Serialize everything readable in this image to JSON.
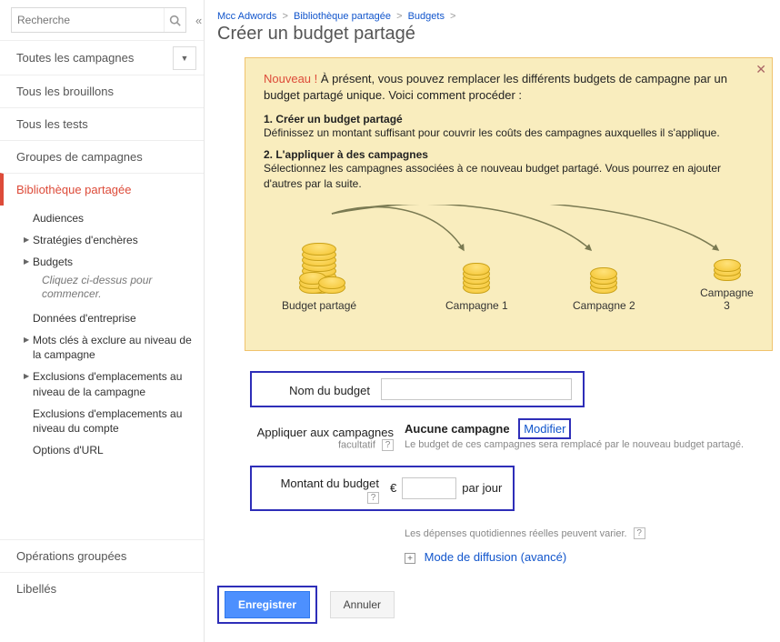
{
  "sidebar": {
    "search_placeholder": "Recherche",
    "all_campaigns": "Toutes les campagnes",
    "items": [
      {
        "label": "Tous les brouillons"
      },
      {
        "label": "Tous les tests"
      },
      {
        "label": "Groupes de campagnes"
      },
      {
        "label": "Bibliothèque partagée"
      }
    ],
    "shared_library_sub": [
      {
        "label": "Audiences",
        "arrow": false
      },
      {
        "label": "Stratégies d'enchères",
        "arrow": true
      },
      {
        "label": "Budgets",
        "arrow": true,
        "hint": "Cliquez ci-dessus pour commencer."
      },
      {
        "label": "Données d'entreprise",
        "arrow": false
      },
      {
        "label": "Mots clés à exclure au niveau de la campagne",
        "arrow": true
      },
      {
        "label": "Exclusions d'emplacements au niveau de la campagne",
        "arrow": true
      },
      {
        "label": "Exclusions d'emplacements au niveau du compte",
        "arrow": false
      },
      {
        "label": "Options d'URL",
        "arrow": false
      }
    ],
    "bulk_ops": "Opérations groupées",
    "labels": "Libellés"
  },
  "breadcrumbs": {
    "a": "Mcc Adwords",
    "b": "Bibliothèque partagée",
    "c": "Budgets"
  },
  "page_title": "Créer un budget partagé",
  "promo": {
    "tag": "Nouveau !",
    "lead": "À présent, vous pouvez remplacer les différents budgets de campagne par un budget partagé unique. Voici comment procéder :",
    "step1_t": "1. Créer un budget partagé",
    "step1_d": "Définissez un montant suffisant pour couvrir les coûts des campagnes auxquelles il s'applique.",
    "step2_t": "2. L'appliquer à des campagnes",
    "step2_d": "Sélectionnez les campagnes associées à ce nouveau budget partagé. Vous pourrez en ajouter d'autres par la suite.",
    "cap_shared": "Budget partagé",
    "cap_c1": "Campagne 1",
    "cap_c2": "Campagne 2",
    "cap_c3": "Campagne 3"
  },
  "form": {
    "name_label": "Nom du budget",
    "name_value": "",
    "apply_label": "Appliquer aux campagnes",
    "apply_sub": "facultatif",
    "no_campaign": "Aucune campagne",
    "modify": "Modifier",
    "apply_hint": "Le budget de ces campagnes sera remplacé par le nouveau budget partagé.",
    "amount_label": "Montant du budget",
    "currency": "€",
    "amount_value": "",
    "per_day": "par jour",
    "spend_note": "Les dépenses quotidiennes réelles peuvent varier.",
    "delivery": "Mode de diffusion (avancé)"
  },
  "actions": {
    "save": "Enregistrer",
    "cancel": "Annuler"
  }
}
